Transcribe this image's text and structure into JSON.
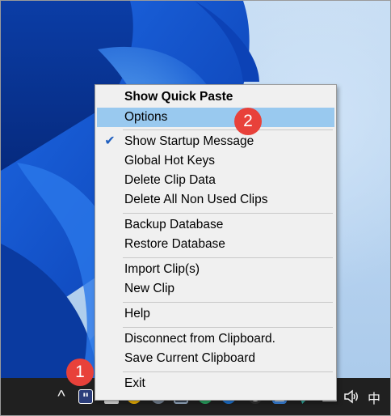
{
  "menu": {
    "items": [
      {
        "label": "Show Quick Paste",
        "bold": true
      },
      {
        "label": "Options",
        "highlighted": true
      },
      {
        "label": "Show Startup Message",
        "checked": true
      },
      {
        "label": "Global Hot Keys"
      },
      {
        "label": "Delete Clip Data"
      },
      {
        "label": "Delete All Non Used Clips"
      },
      {
        "label": "Backup Database"
      },
      {
        "label": "Restore Database"
      },
      {
        "label": "Import Clip(s)"
      },
      {
        "label": "New Clip"
      },
      {
        "label": "Help"
      },
      {
        "label": "Disconnect from Clipboard."
      },
      {
        "label": "Save Current Clipboard"
      },
      {
        "label": "Exit"
      }
    ],
    "check_glyph": "✔"
  },
  "annotations": {
    "badge_1": "1",
    "badge_2": "2"
  },
  "taskbar": {
    "chevron_glyph": "^",
    "ditto_glyph": "\"",
    "language": "中",
    "tray_icons": [
      "ditto-icon",
      "app-icon",
      "browser-icon",
      "app-icon",
      "monitor-icon",
      "chat-icon",
      "app-icon",
      "game-icon",
      "app-icon",
      "network-icon",
      "volume-icon"
    ]
  },
  "colors": {
    "accent_highlight": "#99c9ef",
    "badge": "#e8413a",
    "wallpaper_blue": "#0a46c8"
  }
}
